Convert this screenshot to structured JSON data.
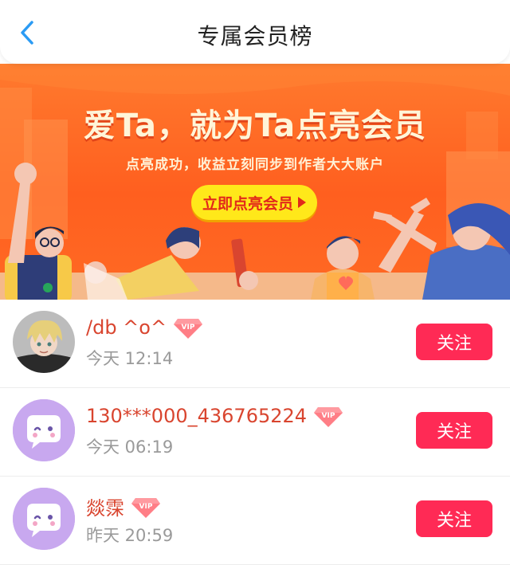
{
  "header": {
    "title": "专属会员榜",
    "back_icon": "chevron-left-icon"
  },
  "banner": {
    "title": "爱Ta，就为Ta点亮会员",
    "subtitle": "点亮成功，收益立刻同步到作者大大账户",
    "cta_label": "立即点亮会员",
    "colors": {
      "background": "#ff6a24",
      "cta": "#ffe81a",
      "cta_text": "#e2281a"
    }
  },
  "members": [
    {
      "name": "/db ^o^",
      "time": "今天 12:14",
      "avatar": "user-photo-avatar",
      "vip": "VIP",
      "follow_label": "关注"
    },
    {
      "name": "130***000_436765224",
      "time": "今天 06:19",
      "avatar": "default-chat-avatar",
      "vip": "VIP",
      "follow_label": "关注"
    },
    {
      "name": "燚霂",
      "time": "昨天 20:59",
      "avatar": "default-chat-avatar",
      "vip": "VIP",
      "follow_label": "关注"
    }
  ],
  "colors": {
    "name": "#d9452f",
    "time": "#9a9a9a",
    "follow_button": "#ff2a55",
    "back_icon": "#2b9bf4"
  }
}
